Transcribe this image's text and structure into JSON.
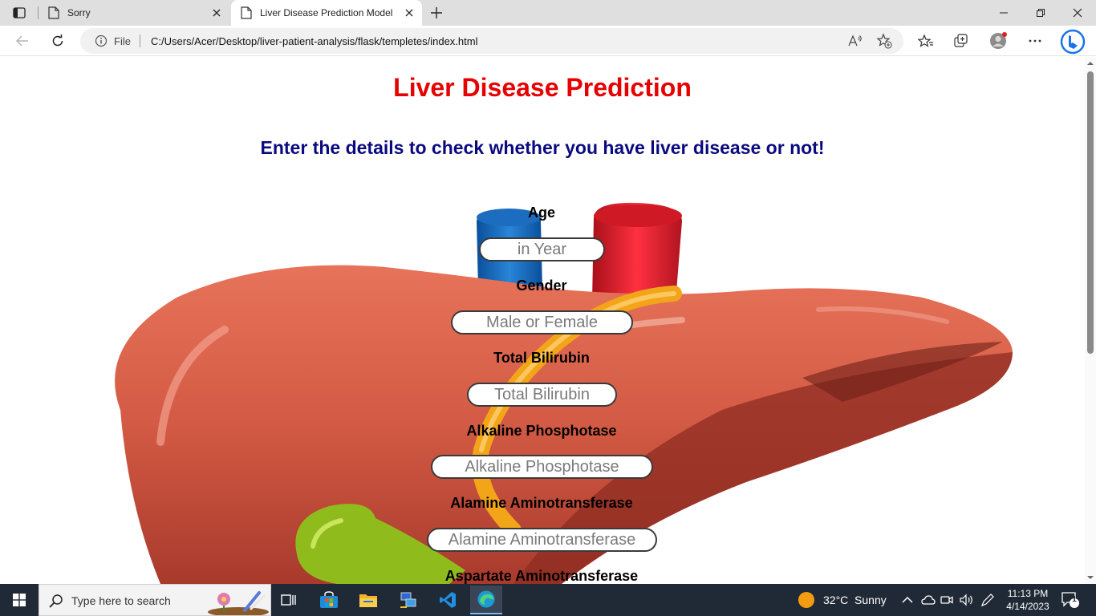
{
  "browser": {
    "tabs": [
      {
        "title": "Sorry"
      },
      {
        "title": "Liver Disease Prediction Model"
      }
    ],
    "address": {
      "file_label": "File",
      "url": "C:/Users/Acer/Desktop/liver-patient-analysis/flask/templetes/index.html"
    }
  },
  "page": {
    "title": "Liver Disease Prediction",
    "subtitle": "Enter the details to check whether you have liver disease or not!",
    "fields": [
      {
        "label": "Age",
        "placeholder": "in Year"
      },
      {
        "label": "Gender",
        "placeholder": "Male or Female"
      },
      {
        "label": "Total Bilirubin",
        "placeholder": "Total Bilirubin"
      },
      {
        "label": "Alkaline Phosphotase",
        "placeholder": "Alkaline Phosphotase"
      },
      {
        "label": "Alamine Aminotransferase",
        "placeholder": "Alamine Aminotransferase"
      },
      {
        "label": "Aspartate Aminotransferase"
      }
    ]
  },
  "taskbar": {
    "search_placeholder": "Type here to search",
    "weather": "32°C  Sunny",
    "time": "11:13 PM",
    "date": "4/14/2023",
    "notifications": "1"
  },
  "colors": {
    "title": "#e60000",
    "subtitle": "#0a0a80",
    "taskbar": "#202a36"
  }
}
